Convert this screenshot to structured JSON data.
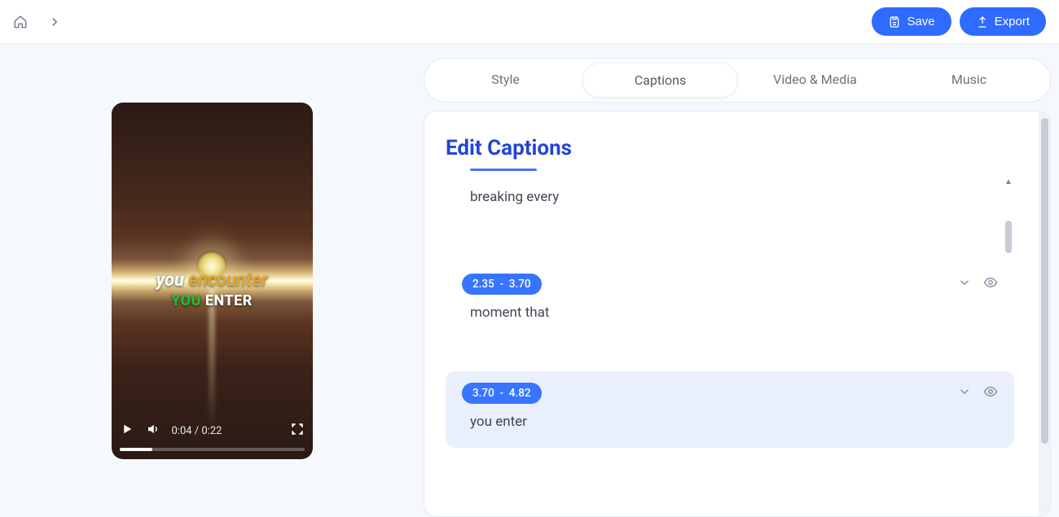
{
  "header": {
    "save_label": "Save",
    "export_label": "Export"
  },
  "video": {
    "caption_word1": "you ",
    "caption_word2": "encounter",
    "caption2_word1": "YOU ",
    "caption2_word2": "ENTER",
    "time_display": "0:04 / 0:22"
  },
  "tabs": {
    "style": "Style",
    "captions": "Captions",
    "video_media": "Video & Media",
    "music": "Music"
  },
  "editor": {
    "title": "Edit Captions",
    "prev_text": "breaking every",
    "segments": [
      {
        "start": "2.35",
        "end": "3.70",
        "text": "moment that",
        "active": false
      },
      {
        "start": "3.70",
        "end": "4.82",
        "text": "you enter",
        "active": true
      }
    ]
  }
}
